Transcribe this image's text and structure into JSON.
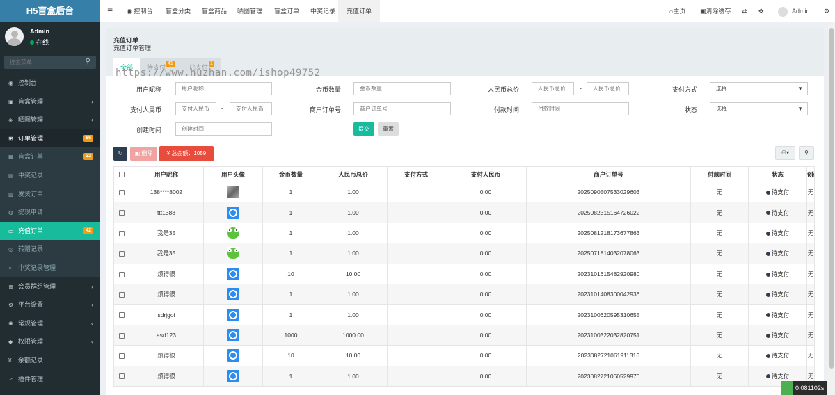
{
  "sidebar": {
    "brand": "H5盲盒后台",
    "user": {
      "name": "Admin",
      "status": "在线"
    },
    "search_placeholder": "搜索菜单",
    "items": [
      {
        "label": "控制台",
        "icon": "dashboard-icon",
        "arrow": "",
        "badge": ""
      },
      {
        "label": "盲盒管理",
        "icon": "briefcase-icon",
        "arrow": "‹",
        "badge": ""
      },
      {
        "label": "晒图管理",
        "icon": "shield-icon",
        "arrow": "‹",
        "badge": ""
      },
      {
        "label": "订单管理",
        "icon": "cart-icon",
        "arrow": "",
        "badge": "86"
      },
      {
        "label": "盲盒订单",
        "icon": "calendar-icon",
        "arrow": "",
        "badge": "22"
      },
      {
        "label": "中奖记录",
        "icon": "inbox-icon",
        "arrow": "",
        "badge": ""
      },
      {
        "label": "发货订单",
        "icon": "truck-icon",
        "arrow": "",
        "badge": ""
      },
      {
        "label": "提现申请",
        "icon": "chat-icon",
        "arrow": "",
        "badge": ""
      },
      {
        "label": "充值订单",
        "icon": "card-icon",
        "arrow": "",
        "badge": "42"
      },
      {
        "label": "转赠记录",
        "icon": "eye-icon",
        "arrow": "",
        "badge": ""
      },
      {
        "label": "中奖记录管理",
        "icon": "circle-icon",
        "arrow": "",
        "badge": ""
      },
      {
        "label": "会员群组管理",
        "icon": "list-icon",
        "arrow": "‹",
        "badge": ""
      },
      {
        "label": "平台设置",
        "icon": "gear-icon",
        "arrow": "‹",
        "badge": ""
      },
      {
        "label": "常规管理",
        "icon": "cogs-icon",
        "arrow": "‹",
        "badge": ""
      },
      {
        "label": "权限管理",
        "icon": "users-icon",
        "arrow": "‹",
        "badge": ""
      },
      {
        "label": "余额记录",
        "icon": "yen-icon",
        "arrow": "",
        "badge": ""
      },
      {
        "label": "插件管理",
        "icon": "rocket-icon",
        "arrow": "",
        "badge": ""
      }
    ]
  },
  "header": {
    "tabs": [
      "控制台",
      "盲盒分类",
      "盲盒商品",
      "晒图管理",
      "盲盒订单",
      "中奖记录",
      "充值订单"
    ],
    "right": {
      "home": "主页",
      "clear_cache": "清除缓存",
      "user": "Admin"
    }
  },
  "panel": {
    "title": "充值订单",
    "subtitle": "充值订单管理"
  },
  "status_tabs": [
    {
      "label": "全部",
      "badge": ""
    },
    {
      "label": "待支付",
      "badge": "41"
    },
    {
      "label": "已支付",
      "badge": "1"
    }
  ],
  "watermark": "https://www.huzhan.com/ishop49752",
  "filters": {
    "nickname": {
      "label": "用户昵称",
      "placeholder": "用户昵称"
    },
    "coins": {
      "label": "金币数量",
      "placeholder": "金币数量"
    },
    "rmb_total": {
      "label": "人民币总价",
      "placeholder": "人民币总价"
    },
    "pay_method": {
      "label": "支付方式",
      "value": "选择"
    },
    "pay_rmb": {
      "label": "支付人民币",
      "placeholder": "支付人民币"
    },
    "merchant_no": {
      "label": "商户订单号",
      "placeholder": "商户订单号"
    },
    "pay_time": {
      "label": "付款时间",
      "placeholder": "付款时间"
    },
    "status": {
      "label": "状态",
      "value": "选择"
    },
    "create_time": {
      "label": "创建时间",
      "placeholder": "创建时间"
    },
    "submit": "提交",
    "reset": "重置"
  },
  "toolbar": {
    "delete": "删除",
    "total": "总金额：1059"
  },
  "table": {
    "headers": [
      "用户昵称",
      "用户头像",
      "金币数量",
      "人民币总价",
      "支付方式",
      "支付人民币",
      "商户订单号",
      "付款时间",
      "状态",
      "创建时间"
    ],
    "rows": [
      {
        "nickname": "138****8002",
        "avatar": "photo",
        "coins": "1",
        "rmb": "1.00",
        "method": "",
        "paid": "0.00",
        "order_no": "2025090507533029603",
        "pay_time": "无",
        "status": "待支付",
        "created": "无"
      },
      {
        "nickname": "ttt1388",
        "avatar": "blue",
        "coins": "1",
        "rmb": "1.00",
        "method": "",
        "paid": "0.00",
        "order_no": "2025082315164726022",
        "pay_time": "无",
        "status": "待支付",
        "created": "无"
      },
      {
        "nickname": "我是35",
        "avatar": "frog",
        "coins": "1",
        "rmb": "1.00",
        "method": "",
        "paid": "0.00",
        "order_no": "2025081218173677863",
        "pay_time": "无",
        "status": "待支付",
        "created": "无"
      },
      {
        "nickname": "我是35",
        "avatar": "frog",
        "coins": "1",
        "rmb": "1.00",
        "method": "",
        "paid": "0.00",
        "order_no": "2025071814032078063",
        "pay_time": "无",
        "status": "待支付",
        "created": "无"
      },
      {
        "nickname": "烦得很",
        "avatar": "blue",
        "coins": "10",
        "rmb": "10.00",
        "method": "",
        "paid": "0.00",
        "order_no": "2023101615482920980",
        "pay_time": "无",
        "status": "待支付",
        "created": "无"
      },
      {
        "nickname": "烦得很",
        "avatar": "blue",
        "coins": "1",
        "rmb": "1.00",
        "method": "",
        "paid": "0.00",
        "order_no": "2023101408300042936",
        "pay_time": "无",
        "status": "待支付",
        "created": "无"
      },
      {
        "nickname": "sdrjgoi",
        "avatar": "blue",
        "coins": "1",
        "rmb": "1.00",
        "method": "",
        "paid": "0.00",
        "order_no": "2023100620595310655",
        "pay_time": "无",
        "status": "待支付",
        "created": "无"
      },
      {
        "nickname": "asd123",
        "avatar": "blue",
        "coins": "1000",
        "rmb": "1000.00",
        "method": "",
        "paid": "0.00",
        "order_no": "2023100322032820751",
        "pay_time": "无",
        "status": "待支付",
        "created": "无"
      },
      {
        "nickname": "烦得很",
        "avatar": "blue",
        "coins": "10",
        "rmb": "10.00",
        "method": "",
        "paid": "0.00",
        "order_no": "2023082721061911316",
        "pay_time": "无",
        "status": "待支付",
        "created": "无"
      },
      {
        "nickname": "烦得很",
        "avatar": "blue",
        "coins": "1",
        "rmb": "1.00",
        "method": "",
        "paid": "0.00",
        "order_no": "2023082721060529970",
        "pay_time": "无",
        "status": "待支付",
        "created": "无"
      }
    ]
  },
  "timer": "0.081102s",
  "colors": {
    "sidebar": "#222d32",
    "accent": "#18bc9c",
    "brand": "#367fa9",
    "badge": "#f39c12",
    "danger": "#e74c3c"
  }
}
